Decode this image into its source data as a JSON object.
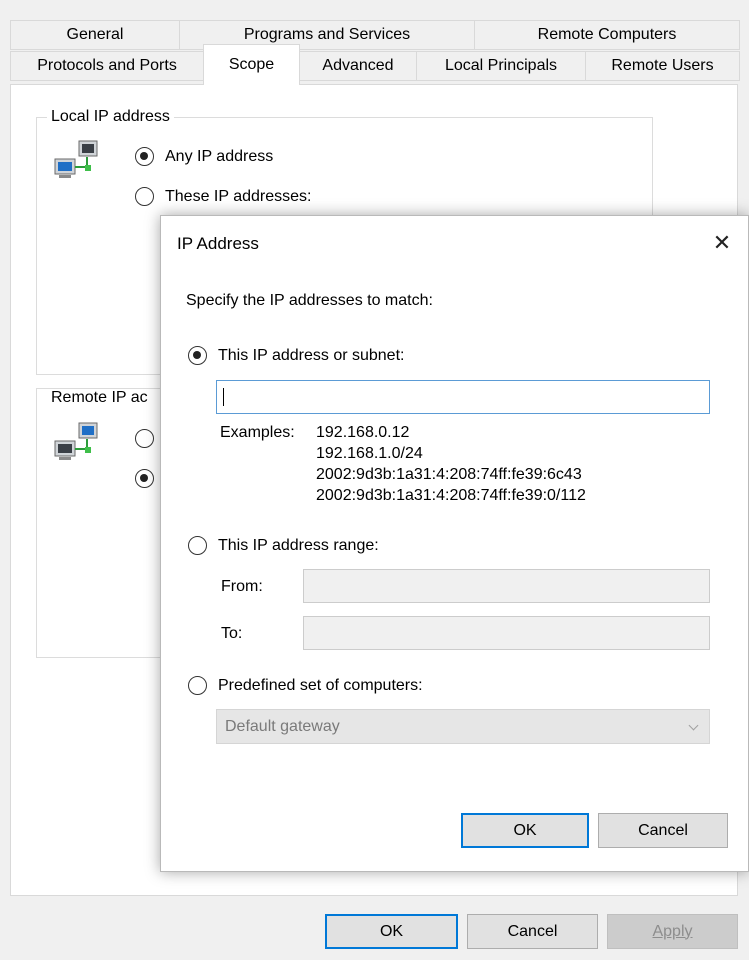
{
  "tabs": {
    "row1": [
      "General",
      "Programs and Services",
      "Remote Computers"
    ],
    "row2": [
      "Protocols and Ports",
      "Scope",
      "Advanced",
      "Local Principals",
      "Remote Users"
    ],
    "selected": "Scope"
  },
  "local_group": {
    "title": "Local IP address",
    "any_ip": "Any IP address",
    "these_ips": "These IP addresses:",
    "selected": "any_ip"
  },
  "remote_group": {
    "title_visible": "Remote IP ac"
  },
  "dialog": {
    "title": "IP Address",
    "close_glyph": "✕",
    "instruction": "Specify the IP addresses to match:",
    "option_subnet": "This IP address or subnet:",
    "subnet_value": "",
    "examples_label": "Examples:",
    "examples": [
      "192.168.0.12",
      "192.168.1.0/24",
      "2002:9d3b:1a31:4:208:74ff:fe39:6c43",
      "2002:9d3b:1a31:4:208:74ff:fe39:0/112"
    ],
    "option_range": "This IP address range:",
    "from_label": "From:",
    "to_label": "To:",
    "from_value": "",
    "to_value": "",
    "option_predefined": "Predefined set of computers:",
    "predefined_selected": "Default gateway",
    "ok_label": "OK",
    "cancel_label": "Cancel",
    "selected_option": "subnet"
  },
  "footer": {
    "ok_label": "OK",
    "cancel_label": "Cancel",
    "apply_label": "Apply"
  },
  "icons": {
    "network": "network-computers-icon",
    "close": "close-icon",
    "chevron": "chevron-down-icon"
  },
  "colors": {
    "accent": "#0078d7",
    "input_border": "#5b9bd5"
  }
}
